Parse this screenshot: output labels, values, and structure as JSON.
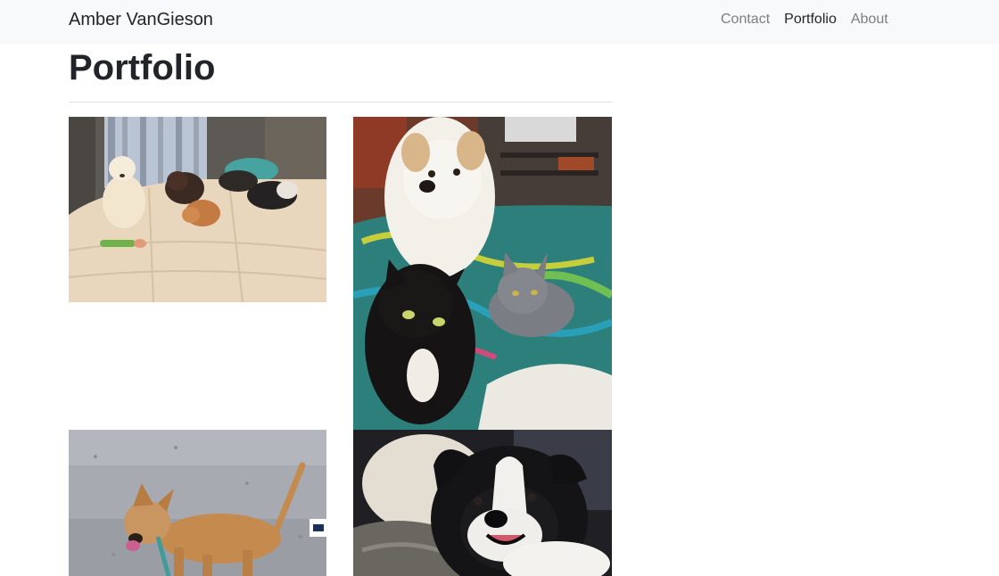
{
  "navbar": {
    "brand": "Amber VanGieson",
    "links": [
      {
        "label": "Contact",
        "active": false
      },
      {
        "label": "Portfolio",
        "active": true
      },
      {
        "label": "About",
        "active": false
      }
    ]
  },
  "main": {
    "title": "Portfolio"
  },
  "colors": {
    "navbar_bg": "#f8f9fa",
    "text": "#212529",
    "muted_link": "#7b7e82",
    "rule": "#dee2e6"
  }
}
